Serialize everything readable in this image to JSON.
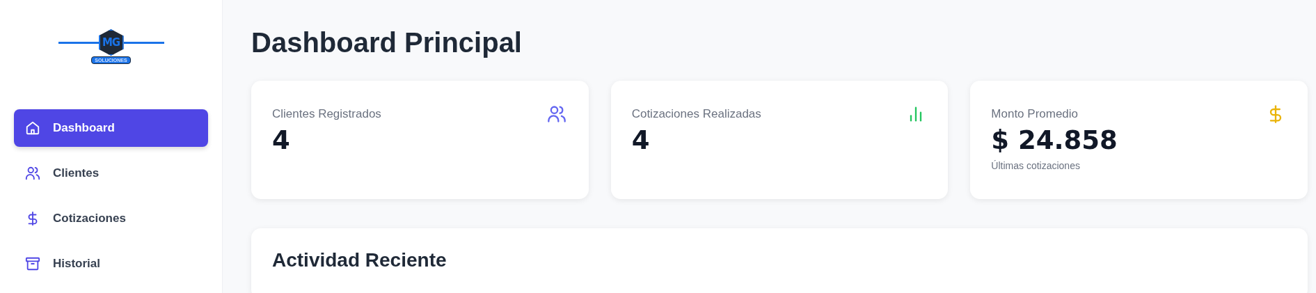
{
  "sidebar": {
    "logo": {
      "mark": "MG",
      "caption": "SOLUCIONES"
    },
    "items": [
      {
        "label": "Dashboard",
        "kind": "home",
        "selected": true
      },
      {
        "label": "Clientes",
        "kind": "users",
        "selected": false
      },
      {
        "label": "Cotizaciones",
        "kind": "dollar",
        "selected": false
      },
      {
        "label": "Historial",
        "kind": "archive",
        "selected": false
      }
    ]
  },
  "page_title": "Dashboard Principal",
  "stat_cards": [
    {
      "label": "Clientes Registrados",
      "value": "4",
      "kind": "users",
      "color": "#6366f1"
    },
    {
      "label": "Cotizaciones Realizadas",
      "value": "4",
      "kind": "chart",
      "color": "#22c55e"
    },
    {
      "label": "Monto Promedio",
      "value": "$ 24.858",
      "note": "Últimas cotizaciones",
      "kind": "dollar",
      "color": "#eab308"
    }
  ],
  "activity": {
    "title": "Actividad Reciente"
  }
}
